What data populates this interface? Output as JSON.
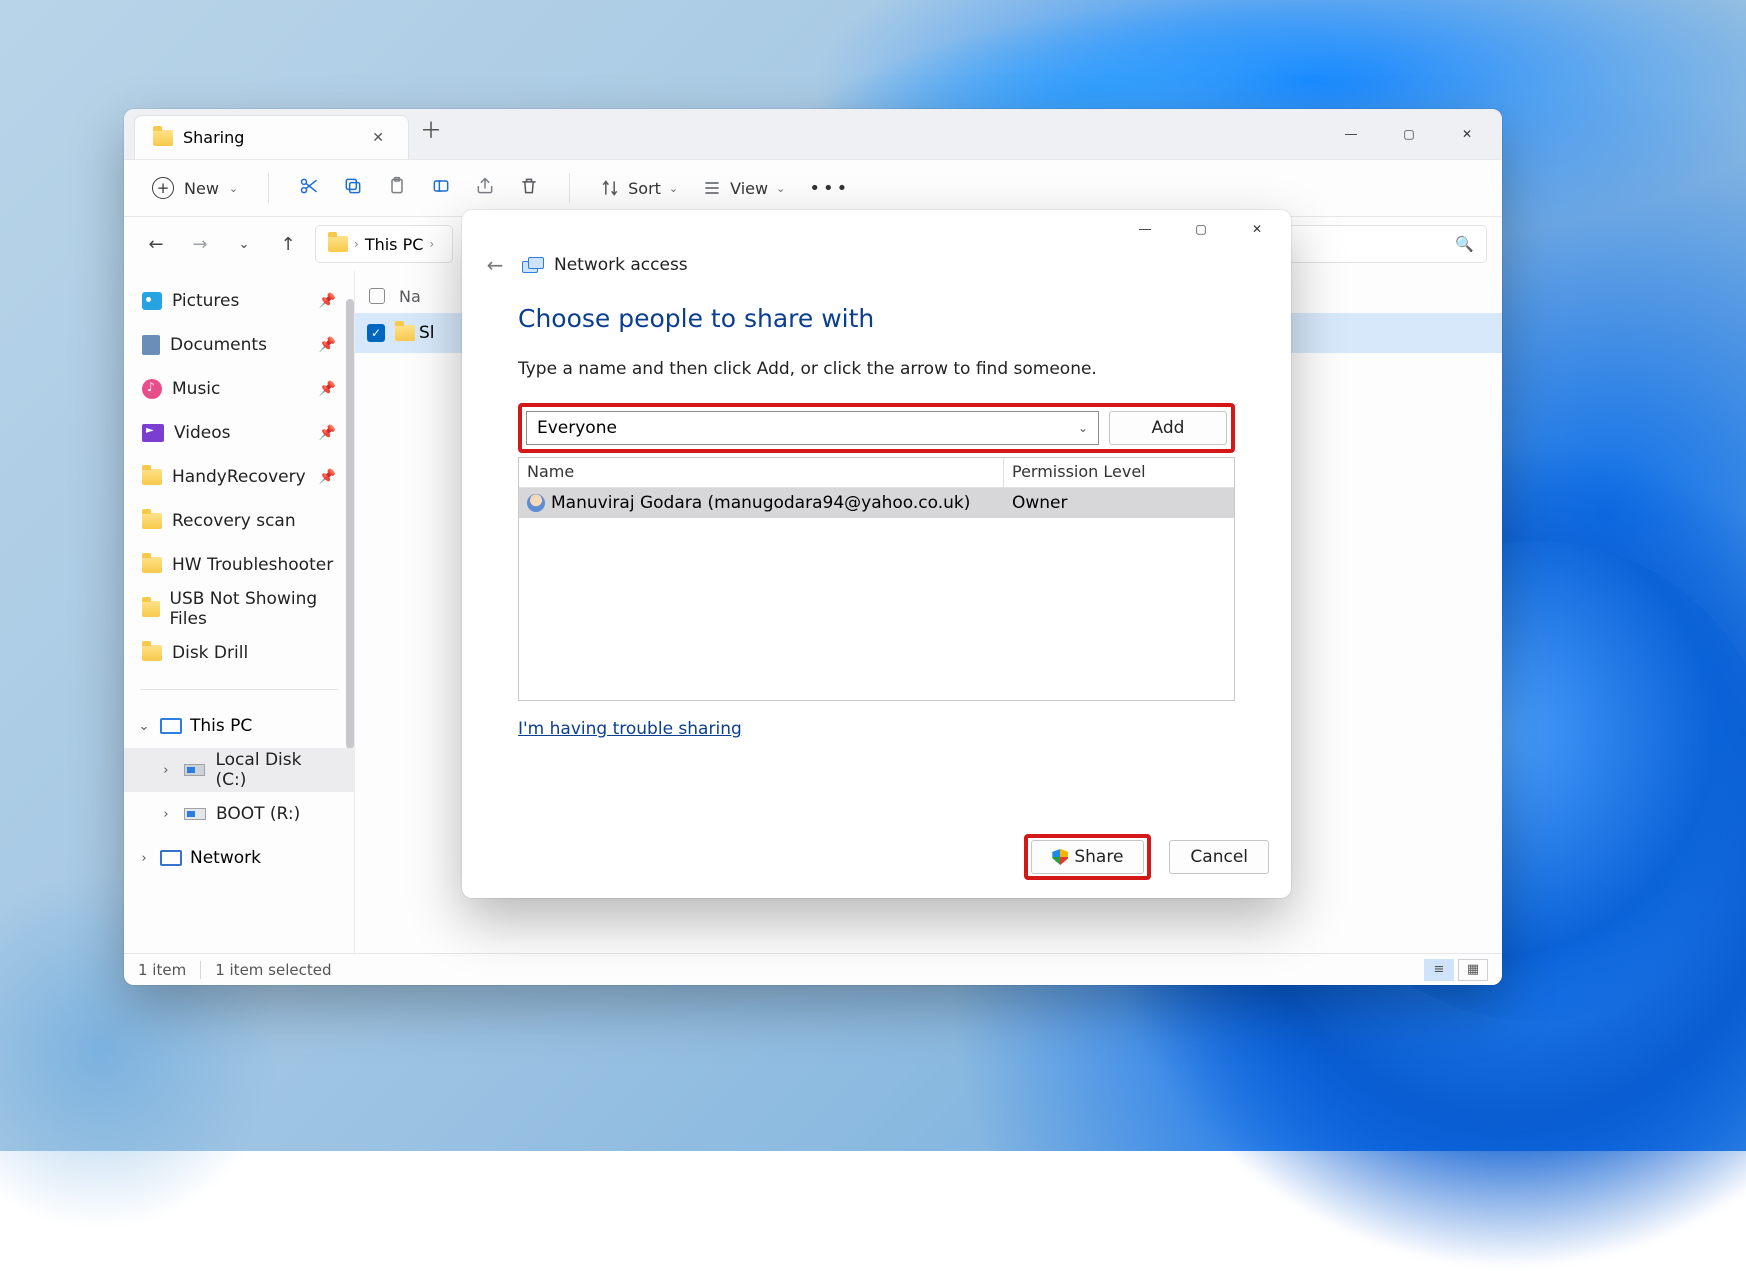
{
  "explorer": {
    "tab": {
      "title": "Sharing"
    },
    "toolbar": {
      "new_label": "New",
      "sort_label": "Sort",
      "view_label": "View"
    },
    "breadcrumb": {
      "items": [
        "This PC"
      ]
    },
    "navpane": {
      "quick": [
        {
          "label": "Pictures",
          "icon": "pictures"
        },
        {
          "label": "Documents",
          "icon": "documents"
        },
        {
          "label": "Music",
          "icon": "music"
        },
        {
          "label": "Videos",
          "icon": "videos"
        },
        {
          "label": "HandyRecovery",
          "icon": "folder"
        },
        {
          "label": "Recovery scan",
          "icon": "folder"
        },
        {
          "label": "HW Troubleshooter",
          "icon": "folder"
        },
        {
          "label": "USB Not Showing Files",
          "icon": "folder"
        },
        {
          "label": "Disk Drill",
          "icon": "folder"
        }
      ],
      "thispc": {
        "label": "This PC",
        "children": [
          {
            "label": "Local Disk (C:)"
          },
          {
            "label": "BOOT (R:)"
          }
        ]
      },
      "network": {
        "label": "Network"
      }
    },
    "content": {
      "col_name": "Na",
      "rows": [
        {
          "name": "Sl",
          "selected": true
        }
      ]
    },
    "status": {
      "count": "1 item",
      "selected": "1 item selected"
    }
  },
  "dialog": {
    "title": "Network access",
    "heading": "Choose people to share with",
    "subtext": "Type a name and then click Add, or click the arrow to find someone.",
    "combo_value": "Everyone",
    "add_label": "Add",
    "columns": {
      "name": "Name",
      "perm": "Permission Level"
    },
    "rows": [
      {
        "user": "Manuviraj Godara (manugodara94@yahoo.co.uk)",
        "perm": "Owner"
      }
    ],
    "trouble_link": "I'm having trouble sharing",
    "share_label": "Share",
    "cancel_label": "Cancel"
  }
}
